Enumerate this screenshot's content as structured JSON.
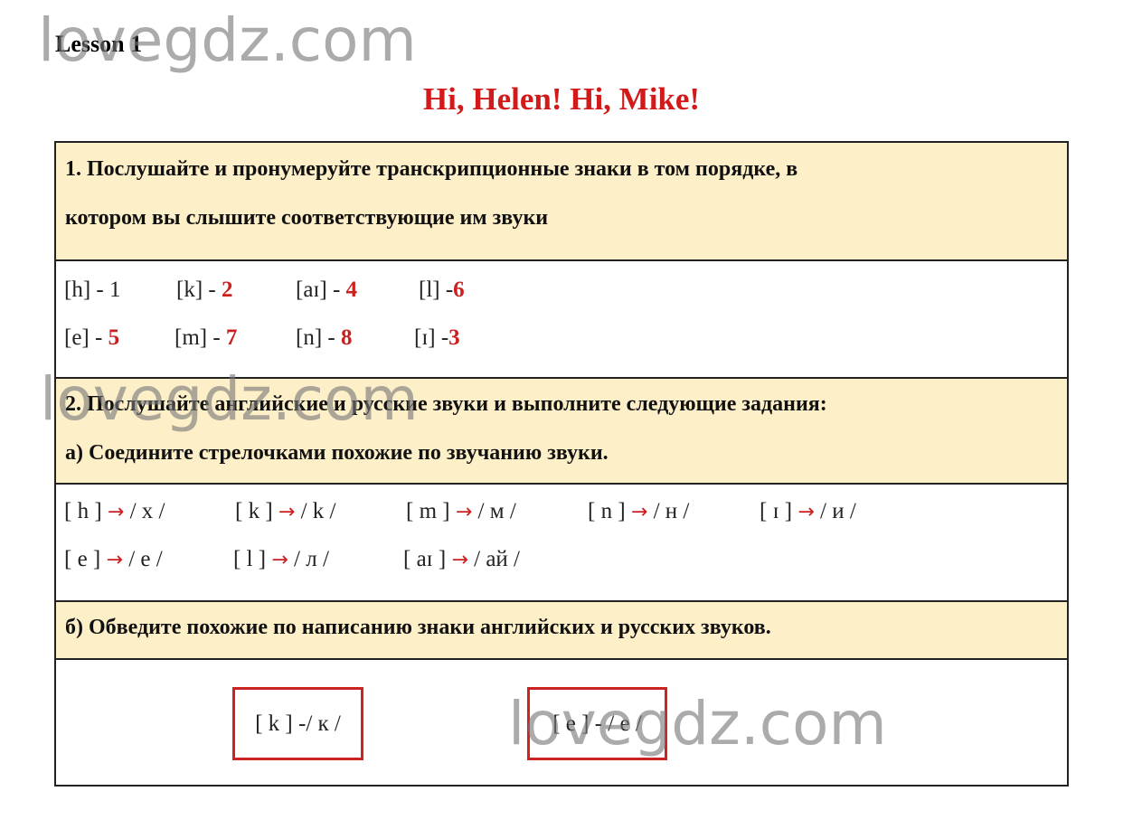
{
  "header": {
    "lesson": "Lesson 1",
    "title": "Hi, Helen! Hi, Mike!"
  },
  "watermark": "lovegdz.com",
  "task1": {
    "line1": "1. Послушайте и пронумеруйте транскрипционные знаки в том порядке, в",
    "line2": "котором вы слышите соответствующие им звуки",
    "items": [
      {
        "sym": "[h] - ",
        "num": "1",
        "plain": true
      },
      {
        "sym": "[k] - ",
        "num": "2"
      },
      {
        "sym": "[aɪ] - ",
        "num": "4"
      },
      {
        "sym": "[l] -",
        "num": "6"
      },
      {
        "sym": "[e] - ",
        "num": "5"
      },
      {
        "sym": "[m] - ",
        "num": "7"
      },
      {
        "sym": "[n] - ",
        "num": "8"
      },
      {
        "sym": "[ɪ] -",
        "num": "3"
      }
    ]
  },
  "task2": {
    "line1": "2. Послушайте английские и русские звуки и выполните следующие задания:",
    "line2": "а) Соедините стрелочками похожие по звучанию звуки.",
    "arrow": "→",
    "pairs": [
      {
        "en": "[ h ] ",
        "ru": " / х /"
      },
      {
        "en": "[ k ] ",
        "ru": " / k /"
      },
      {
        "en": "[ m ] ",
        "ru": " / м /"
      },
      {
        "en": "[ n ] ",
        "ru": " / н /"
      },
      {
        "en": "[ ɪ ] ",
        "ru": " / и /"
      },
      {
        "en": "[ e ] ",
        "ru": " / е /"
      },
      {
        "en": "[ l ] ",
        "ru": " / л /"
      },
      {
        "en": "[ aɪ ] ",
        "ru": " / ай /"
      }
    ]
  },
  "task3": {
    "line": "б) Обведите похожие по написанию знаки английских и русских звуков.",
    "boxes": [
      "[ k ] -/ к /",
      "[ e ] - / е /"
    ]
  },
  "colors": {
    "accent": "#cc1f1f",
    "highlight": "#fdefc8"
  }
}
